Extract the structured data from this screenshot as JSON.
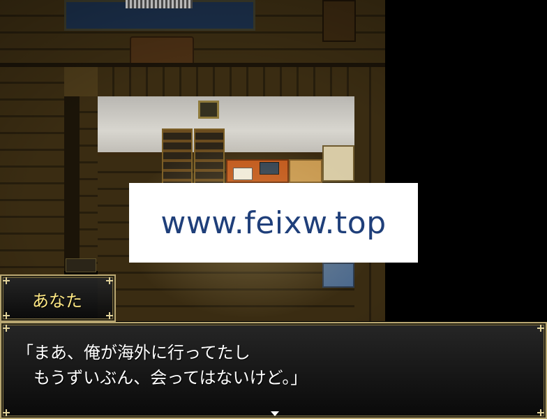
{
  "watermark": {
    "text": "www.feixw.top"
  },
  "dialogue": {
    "speaker": "あなた",
    "lines": [
      "「まあ、俺が海外に行ってたし",
      "　もうずいぶん、会ってはないけど。」"
    ],
    "continue_icon": "down-triangle-icon"
  },
  "colors": {
    "speaker_name": "#ffe985",
    "message_text": "#ffffff",
    "window_border": "#b9a772",
    "watermark_text": "#1f3f7a"
  }
}
